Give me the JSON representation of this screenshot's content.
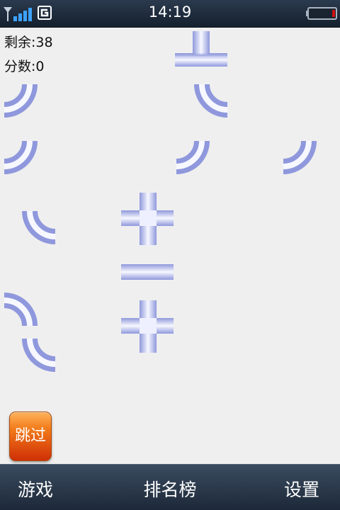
{
  "status_bar": {
    "time": "14:19",
    "network_type": "G",
    "icons": [
      "signal-icon",
      "network-g-icon",
      "battery-icon"
    ],
    "battery_level": 0.12,
    "battery_color": "#d01010"
  },
  "game": {
    "remaining_label": "剩余:38",
    "score_label": "分数:0",
    "pipe_color": "#a4ace6",
    "pieces": [
      {
        "id": "tee-top",
        "kind": "tee-up"
      },
      {
        "id": "elbow-1",
        "kind": "elbow-sw"
      },
      {
        "id": "elbow-2",
        "kind": "elbow-se"
      },
      {
        "id": "elbow-3",
        "kind": "elbow-sw"
      },
      {
        "id": "elbow-4",
        "kind": "elbow-sw"
      },
      {
        "id": "elbow-5",
        "kind": "elbow-sw"
      },
      {
        "id": "elbow-6",
        "kind": "elbow-se"
      },
      {
        "id": "cross-1",
        "kind": "cross"
      },
      {
        "id": "straight-1",
        "kind": "straight-h"
      },
      {
        "id": "elbow-7",
        "kind": "elbow-sw"
      },
      {
        "id": "cross-2",
        "kind": "cross"
      },
      {
        "id": "elbow-8",
        "kind": "elbow-se"
      }
    ]
  },
  "skip_button": {
    "label": "跳过"
  },
  "nav": {
    "game": "游戏",
    "leaderboard": "排名榜",
    "settings": "设置"
  }
}
